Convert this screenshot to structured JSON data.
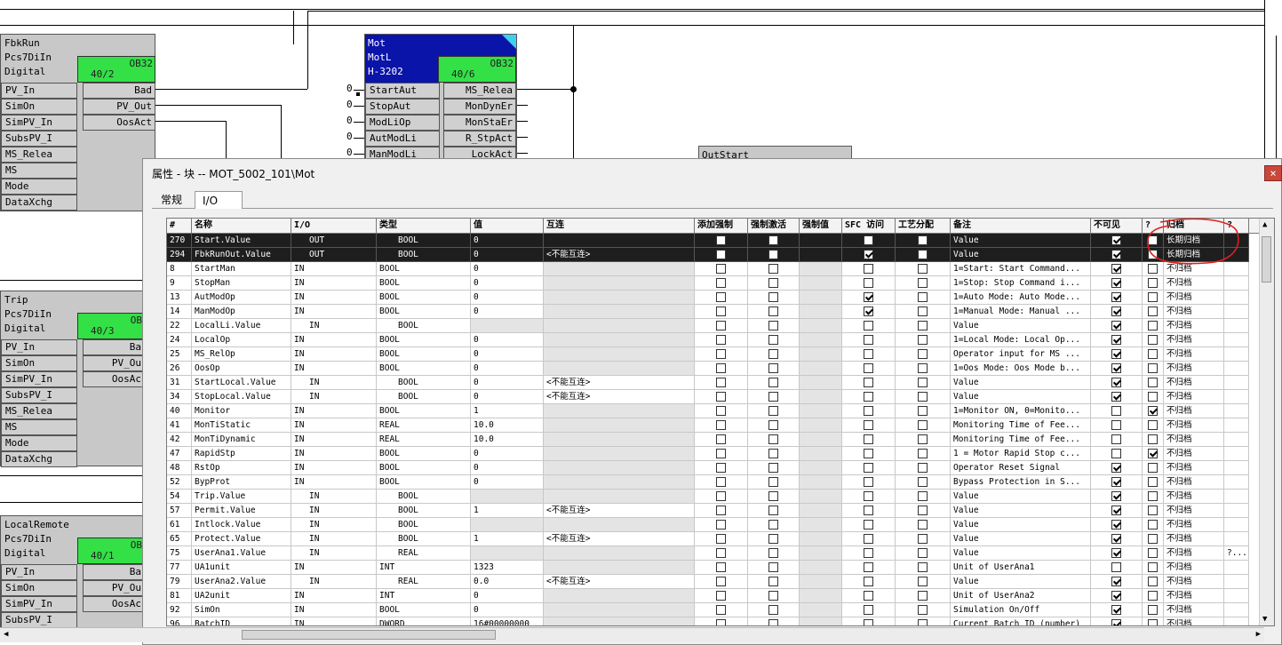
{
  "cfc": {
    "blocks": [
      {
        "id": "fbkrun",
        "h1": "FbkRun",
        "h2": "Pcs7DiIn",
        "h3": "Digital",
        "ob_top": "OB32",
        "ob_bot": "40/2",
        "inputs": [
          "PV_In",
          "SimOn",
          "SimPV_In",
          "SubsPV_I",
          "MS_Relea",
          "MS",
          "Mode",
          "DataXchg"
        ],
        "outputs": [
          "Bad",
          "PV_Out",
          "OosAct"
        ]
      },
      {
        "id": "trip",
        "h1": "Trip",
        "h2": "Pcs7DiIn",
        "h3": "Digital",
        "ob_top": "OB",
        "ob_bot": "40/3",
        "inputs": [
          "PV_In",
          "SimOn",
          "SimPV_In",
          "SubsPV_I",
          "MS_Relea",
          "MS",
          "Mode",
          "DataXchg"
        ],
        "outputs": [
          "Ba",
          "PV_Ou",
          "OosAc"
        ]
      },
      {
        "id": "localremote",
        "h1": "LocalRemote",
        "h2": "Pcs7DiIn",
        "h3": "Digital",
        "ob_top": "OB",
        "ob_bot": "40/1",
        "inputs": [
          "PV_In",
          "SimOn",
          "SimPV_In",
          "SubsPV_I"
        ],
        "outputs": [
          "Ba",
          "PV_Ou",
          "OosAc"
        ]
      }
    ],
    "mot": {
      "h1": "Mot",
      "h2": "MotL",
      "h3": "H-3202",
      "ob_top": "OB32",
      "ob_bot": "40/6",
      "inputs": [
        "StartAut",
        "StopAut",
        "ModLiOp",
        "AutModLi",
        "ManModLi"
      ],
      "outputs": [
        "MS_Relea",
        "MonDynEr",
        "MonStaEr",
        "R_StpAct",
        "LockAct"
      ],
      "pin_marks": [
        "0",
        "0",
        "0",
        "0",
        "0"
      ]
    },
    "outstart": "OutStart"
  },
  "dialog": {
    "title": "属性 - 块 -- MOT_5002_101\\Mot",
    "close": "×",
    "tabs": [
      "常规",
      "I/O"
    ],
    "active_tab": 1,
    "columns": [
      "#",
      "名称",
      "I/O",
      "类型",
      "值",
      "互连",
      "添加强制",
      "强制激活",
      "强制值",
      "SFC 访问",
      "工艺分配",
      "备注",
      "不可见",
      "?",
      "归档",
      "?"
    ],
    "rows": [
      {
        "n": "270",
        "name": "Start.Value",
        "io": "OUT",
        "type": "BOOL",
        "val": "0",
        "ic": "",
        "cmt": "Value",
        "inv": true,
        "q": false,
        "arch": "长期归档",
        "sfc": false,
        "sel": true,
        "struct": true
      },
      {
        "n": "294",
        "name": "FbkRunOut.Value",
        "io": "OUT",
        "type": "BOOL",
        "val": "0",
        "ic": "<不能互连>",
        "cmt": "Value",
        "inv": true,
        "q": false,
        "arch": "长期归档",
        "sfc": true,
        "sel": true,
        "struct": true
      },
      {
        "n": "8",
        "name": "StartMan",
        "io": "IN",
        "type": "BOOL",
        "val": "0",
        "ic": "",
        "cmt": "1=Start: Start Command...",
        "inv": true,
        "q": false,
        "arch": "不归档",
        "sfc": false
      },
      {
        "n": "9",
        "name": "StopMan",
        "io": "IN",
        "type": "BOOL",
        "val": "0",
        "ic": "",
        "cmt": "1=Stop: Stop Command i...",
        "inv": true,
        "q": false,
        "arch": "不归档",
        "sfc": false
      },
      {
        "n": "13",
        "name": "AutModOp",
        "io": "IN",
        "type": "BOOL",
        "val": "0",
        "ic": "",
        "cmt": "1=Auto Mode: Auto Mode...",
        "inv": true,
        "q": false,
        "arch": "不归档",
        "sfc": true
      },
      {
        "n": "14",
        "name": "ManModOp",
        "io": "IN",
        "type": "BOOL",
        "val": "0",
        "ic": "",
        "cmt": "1=Manual Mode: Manual ...",
        "inv": true,
        "q": false,
        "arch": "不归档",
        "sfc": true
      },
      {
        "n": "22",
        "name": "LocalLi.Value",
        "io": "IN",
        "type": "BOOL",
        "val": "",
        "ic": "",
        "cmt": "Value",
        "inv": true,
        "q": false,
        "arch": "不归档",
        "sfc": false,
        "struct": true,
        "gv": true
      },
      {
        "n": "24",
        "name": "LocalOp",
        "io": "IN",
        "type": "BOOL",
        "val": "0",
        "ic": "",
        "cmt": "1=Local Mode: Local Op...",
        "inv": true,
        "q": false,
        "arch": "不归档",
        "sfc": false
      },
      {
        "n": "25",
        "name": "MS_RelOp",
        "io": "IN",
        "type": "BOOL",
        "val": "0",
        "ic": "",
        "cmt": "Operator input for MS ...",
        "inv": true,
        "q": false,
        "arch": "不归档",
        "sfc": false
      },
      {
        "n": "26",
        "name": "OosOp",
        "io": "IN",
        "type": "BOOL",
        "val": "0",
        "ic": "",
        "cmt": "1=Oos Mode: Oos Mode b...",
        "inv": true,
        "q": false,
        "arch": "不归档",
        "sfc": false
      },
      {
        "n": "31",
        "name": "StartLocal.Value",
        "io": "IN",
        "type": "BOOL",
        "val": "0",
        "ic": "<不能互连>",
        "cmt": "Value",
        "inv": true,
        "q": false,
        "arch": "不归档",
        "sfc": false,
        "struct": true
      },
      {
        "n": "34",
        "name": "StopLocal.Value",
        "io": "IN",
        "type": "BOOL",
        "val": "0",
        "ic": "<不能互连>",
        "cmt": "Value",
        "inv": true,
        "q": false,
        "arch": "不归档",
        "sfc": false,
        "struct": true
      },
      {
        "n": "40",
        "name": "Monitor",
        "io": "IN",
        "type": "BOOL",
        "val": "1",
        "ic": "",
        "cmt": "1=Monitor ON, 0=Monito...",
        "inv": false,
        "q": true,
        "arch": "不归档",
        "sfc": false
      },
      {
        "n": "41",
        "name": "MonTiStatic",
        "io": "IN",
        "type": "REAL",
        "val": "10.0",
        "ic": "",
        "cmt": "Monitoring Time of Fee...",
        "inv": false,
        "q": false,
        "arch": "不归档",
        "sfc": false
      },
      {
        "n": "42",
        "name": "MonTiDynamic",
        "io": "IN",
        "type": "REAL",
        "val": "10.0",
        "ic": "",
        "cmt": "Monitoring Time of Fee...",
        "inv": false,
        "q": false,
        "arch": "不归档",
        "sfc": false
      },
      {
        "n": "47",
        "name": "RapidStp",
        "io": "IN",
        "type": "BOOL",
        "val": "0",
        "ic": "",
        "cmt": "1 = Motor Rapid Stop c...",
        "inv": false,
        "q": true,
        "arch": "不归档",
        "sfc": false
      },
      {
        "n": "48",
        "name": "RstOp",
        "io": "IN",
        "type": "BOOL",
        "val": "0",
        "ic": "",
        "cmt": "Operator Reset Signal",
        "inv": true,
        "q": false,
        "arch": "不归档",
        "sfc": false
      },
      {
        "n": "52",
        "name": "BypProt",
        "io": "IN",
        "type": "BOOL",
        "val": "0",
        "ic": "",
        "cmt": "Bypass Protection in S...",
        "inv": true,
        "q": false,
        "arch": "不归档",
        "sfc": false
      },
      {
        "n": "54",
        "name": "Trip.Value",
        "io": "IN",
        "type": "BOOL",
        "val": "",
        "ic": "",
        "cmt": "Value",
        "inv": true,
        "q": false,
        "arch": "不归档",
        "sfc": false,
        "struct": true,
        "gv": true
      },
      {
        "n": "57",
        "name": "Permit.Value",
        "io": "IN",
        "type": "BOOL",
        "val": "1",
        "ic": "<不能互连>",
        "cmt": "Value",
        "inv": true,
        "q": false,
        "arch": "不归档",
        "sfc": false,
        "struct": true
      },
      {
        "n": "61",
        "name": "Intlock.Value",
        "io": "IN",
        "type": "BOOL",
        "val": "",
        "ic": "",
        "cmt": "Value",
        "inv": true,
        "q": false,
        "arch": "不归档",
        "sfc": false,
        "struct": true,
        "gv": true
      },
      {
        "n": "65",
        "name": "Protect.Value",
        "io": "IN",
        "type": "BOOL",
        "val": "1",
        "ic": "<不能互连>",
        "cmt": "Value",
        "inv": true,
        "q": false,
        "arch": "不归档",
        "sfc": false,
        "struct": true
      },
      {
        "n": "75",
        "name": "UserAna1.Value",
        "io": "IN",
        "type": "REAL",
        "val": "",
        "ic": "",
        "cmt": "Value",
        "inv": true,
        "q": false,
        "arch": "不归档",
        "sfc": false,
        "struct": true,
        "gv": true,
        "extra": "?..."
      },
      {
        "n": "77",
        "name": "UA1unit",
        "io": "IN",
        "type": "INT",
        "val": "1323",
        "ic": "",
        "cmt": "Unit of UserAna1",
        "inv": false,
        "q": false,
        "arch": "不归档",
        "sfc": false
      },
      {
        "n": "79",
        "name": "UserAna2.Value",
        "io": "IN",
        "type": "REAL",
        "val": "0.0",
        "ic": "<不能互连>",
        "cmt": "Value",
        "inv": true,
        "q": false,
        "arch": "不归档",
        "sfc": false,
        "struct": true
      },
      {
        "n": "81",
        "name": "UA2unit",
        "io": "IN",
        "type": "INT",
        "val": "0",
        "ic": "",
        "cmt": "Unit of UserAna2",
        "inv": true,
        "q": false,
        "arch": "不归档",
        "sfc": false
      },
      {
        "n": "92",
        "name": "SimOn",
        "io": "IN",
        "type": "BOOL",
        "val": "0",
        "ic": "",
        "cmt": "Simulation On/Off",
        "inv": true,
        "q": false,
        "arch": "不归档",
        "sfc": false
      },
      {
        "n": "96",
        "name": "BatchID",
        "io": "IN",
        "type": "DWORD",
        "val": "16#00000000",
        "ic": "",
        "cmt": "Current Batch ID (number)",
        "inv": true,
        "q": false,
        "arch": "不归档",
        "sfc": false
      }
    ]
  },
  "colors": {
    "mot_header": "#0a14a8",
    "ob_green": "#33e046",
    "selected_row": "#1e1e1e",
    "annotation_red": "#e02020"
  }
}
